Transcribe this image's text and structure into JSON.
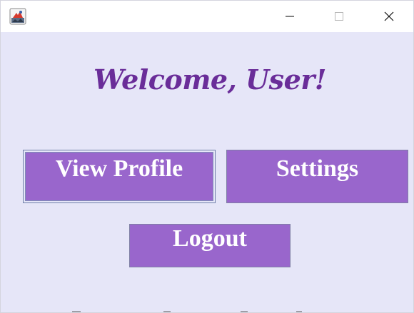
{
  "window": {
    "minimize_glyph": "─",
    "maximize_glyph": "☐",
    "close_glyph": "✕"
  },
  "main": {
    "welcome": "Welcome, User!",
    "buttons": {
      "view_profile": "View Profile",
      "settings": "Settings",
      "logout": "Logout"
    }
  },
  "colors": {
    "background": "#e6e6f8",
    "heading": "#6a2d99",
    "button": "#9966cc",
    "button_text": "#ffffff"
  },
  "icons": {
    "app": "java-app-icon",
    "minimize": "minimize-icon",
    "maximize": "maximize-icon",
    "close": "close-icon"
  }
}
